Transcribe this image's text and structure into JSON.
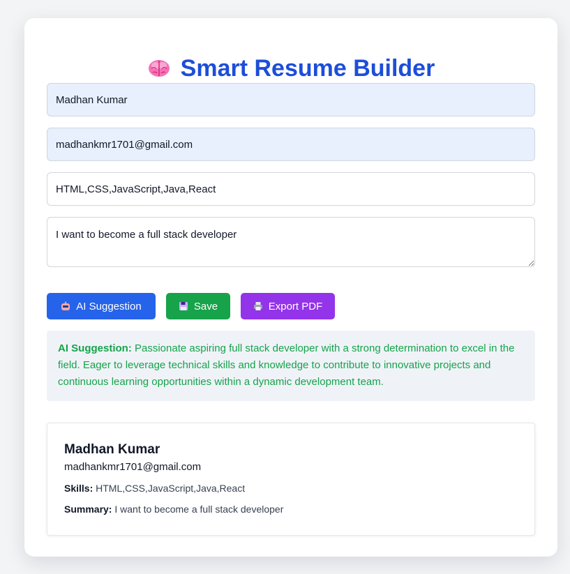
{
  "app": {
    "title": "Smart Resume Builder",
    "title_icon": "brain-icon"
  },
  "form": {
    "name_value": "Madhan Kumar",
    "email_value": "madhankmr1701@gmail.com",
    "skills_value": "HTML,CSS,JavaScript,Java,React",
    "summary_value": "I want to become a full stack developer"
  },
  "buttons": {
    "ai_label": "AI Suggestion",
    "ai_icon": "robot-icon",
    "save_label": "Save",
    "save_icon": "floppy-disk-icon",
    "export_label": "Export PDF",
    "export_icon": "printer-icon"
  },
  "suggestion": {
    "label": "AI Suggestion:",
    "text": "Passionate aspiring full stack developer with a strong determination to excel in the field. Eager to leverage technical skills and knowledge to contribute to innovative projects and continuous learning opportunities within a dynamic development team."
  },
  "preview": {
    "name": "Madhan Kumar",
    "email": "madhankmr1701@gmail.com",
    "skills_label": "Skills:",
    "skills": "HTML,CSS,JavaScript,Java,React",
    "summary_label": "Summary:",
    "summary": "I want to become a full stack developer"
  },
  "colors": {
    "title": "#1d4ed8",
    "ai_button": "#2563eb",
    "save_button": "#16a34a",
    "export_button": "#9333ea",
    "suggestion_text": "#16a34a",
    "autofill_background": "#e8f0fe"
  }
}
